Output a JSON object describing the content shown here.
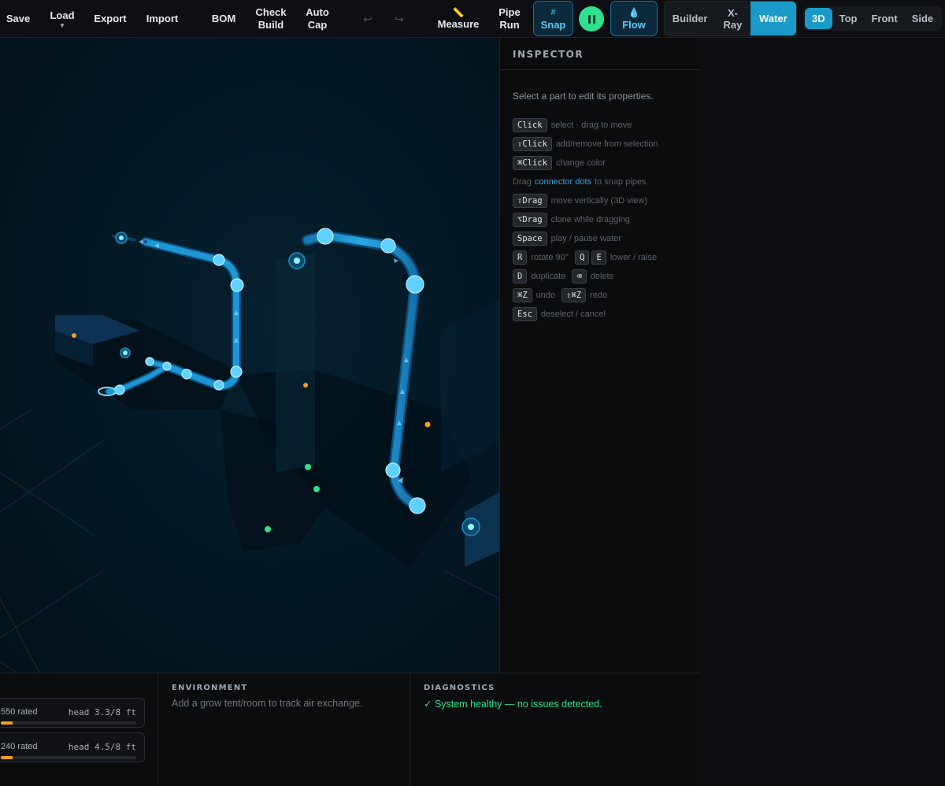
{
  "toolbar": {
    "save": "Save",
    "load": "Load",
    "load_caret": "▾",
    "export": "Export",
    "import": "Import",
    "bom": "BOM",
    "check_build_1": "Check",
    "check_build_2": "Build",
    "auto_cap_1": "Auto",
    "auto_cap_2": "Cap",
    "undo_glyph": "↩",
    "redo_glyph": "↪",
    "measure_glyph": "📏",
    "measure": "Measure",
    "pipe_run_1": "Pipe",
    "pipe_run_2": "Run",
    "snap_glyph": "#",
    "snap": "Snap",
    "flow_glyph": "💧",
    "flow": "Flow",
    "modes": [
      "Builder",
      "X-Ray",
      "Water"
    ],
    "active_mode": "Water",
    "views": [
      "3D",
      "Top",
      "Front",
      "Side"
    ],
    "active_view": "3D"
  },
  "inspector": {
    "title": "INSPECTOR",
    "hint": "Select a part to edit its properties.",
    "shortcuts": {
      "click_key": "Click",
      "click_desc": "select · drag to move",
      "shift_click_key": "⇧Click",
      "shift_click_desc": "add/remove from selection",
      "cmd_click_key": "⌘Click",
      "cmd_click_desc": "change color",
      "drag_pre": "Drag",
      "drag_link": "connector dots",
      "drag_post": "to snap pipes",
      "shift_drag_key": "⇧Drag",
      "shift_drag_desc": "move vertically (3D view)",
      "opt_drag_key": "⌥Drag",
      "opt_drag_desc": "clone while dragging",
      "space_key": "Space",
      "space_desc": "play / pause water",
      "r_key": "R",
      "r_desc": "rotate 90°",
      "q_key": "Q",
      "e_key": "E",
      "qe_desc": "lower / raise",
      "d_key": "D",
      "d_desc": "duplicate",
      "del_key": "⌫",
      "del_desc": "delete",
      "undo_key": "⌘Z",
      "undo_desc": "undo",
      "redo_key": "⇧⌘Z",
      "redo_desc": "redo",
      "esc_key": "Esc",
      "esc_desc": "deselect / cancel"
    }
  },
  "pumps": [
    {
      "rated": "550 rated",
      "head": "head 3.3/8 ft",
      "fill": 0.09
    },
    {
      "rated": "240 rated",
      "head": "head 4.5/8 ft",
      "fill": 0.09
    }
  ],
  "environment": {
    "title": "ENVIRONMENT",
    "body": "Add a grow tent/room to track air exchange."
  },
  "diagnostics": {
    "title": "DIAGNOSTICS",
    "body": "✓ System healthy — no issues detected."
  },
  "colors": {
    "accent": "#1a9ac8",
    "pipe": "#1a86c0",
    "ok": "#2ee08f",
    "warning": "#f0a020"
  }
}
